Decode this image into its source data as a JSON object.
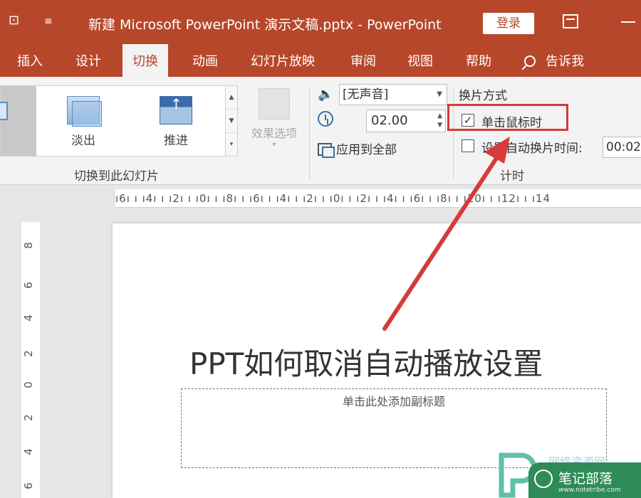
{
  "titlebar": {
    "title": "新建 Microsoft PowerPoint 演示文稿.pptx  -  PowerPoint",
    "login_label": "登录",
    "accent": "#b7472a"
  },
  "tabs": [
    {
      "label": "插入"
    },
    {
      "label": "设计"
    },
    {
      "label": "切换"
    },
    {
      "label": "动画"
    },
    {
      "label": "幻灯片放映"
    },
    {
      "label": "审阅"
    },
    {
      "label": "视图"
    },
    {
      "label": "帮助"
    }
  ],
  "tell_me": "告诉我",
  "ribbon": {
    "gallery": [
      {
        "label": "淡出",
        "icon": "fade-icon"
      },
      {
        "label": "推进",
        "icon": "push-icon"
      }
    ],
    "effect_options_label": "效果选项",
    "group_transition_label": "切换到此幻灯片",
    "sound_value": "[无声音]",
    "duration_value": "02.00",
    "apply_all_label": "应用到全部",
    "advance_label": "换片方式",
    "on_click_label": "单击鼠标时",
    "on_click_checked": true,
    "after_label": "设置自动换片时间:",
    "after_checked": false,
    "after_value": "00:02",
    "group_timing_label": "计时",
    "highlight_color": "#d63a3a"
  },
  "ruler": {
    "horizontal": "ı6ı ı ı4ı ı ı2ı ı ı0ı ı ı8ı ı ı6ı ı ı4ı ı ı2ı ı ı0ı ı ı2ı ı ı4ı ı ı6ı ı ı8ı ı ı10ı ı ı12ı ı ı14",
    "vertical": [
      "8",
      "6",
      "4",
      "2",
      "0",
      "2",
      "4",
      "6"
    ]
  },
  "slide": {
    "title": "PPT如何取消自动播放设置",
    "subtitle_placeholder": "单击此处添加副标题"
  },
  "watermark": {
    "name": "笔记部落",
    "url": "www.notetribe.com",
    "faint": "网络资源网"
  }
}
